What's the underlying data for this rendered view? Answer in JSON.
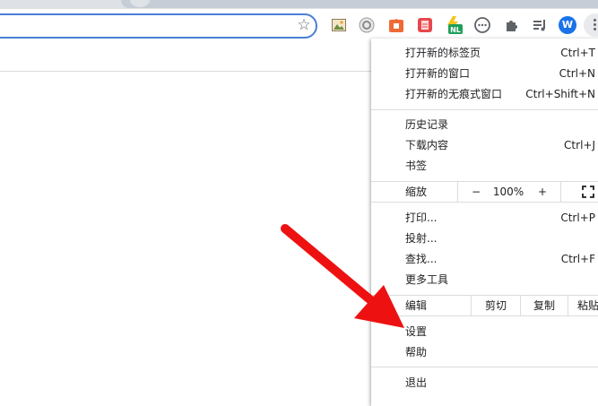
{
  "toolbar": {
    "star_icon": "star-icon",
    "avatar_letter": "W",
    "extensions": [
      "image-extension-icon",
      "gear-extension-icon",
      "shop-extension-icon",
      "red-extension-icon",
      "nl-extension-icon",
      "chat-extension-icon",
      "puzzle-icon",
      "media-icon"
    ],
    "nl_badge": "NL"
  },
  "menu": {
    "new_tab": {
      "label": "打开新的标签页",
      "shortcut": "Ctrl+T"
    },
    "new_window": {
      "label": "打开新的窗口",
      "shortcut": "Ctrl+N"
    },
    "new_incognito": {
      "label": "打开新的无痕式窗口",
      "shortcut": "Ctrl+Shift+N"
    },
    "history": {
      "label": "历史记录"
    },
    "downloads": {
      "label": "下载内容",
      "shortcut": "Ctrl+J"
    },
    "bookmarks": {
      "label": "书签"
    },
    "zoom": {
      "label": "缩放",
      "minus": "−",
      "value": "100%",
      "plus": "+"
    },
    "print": {
      "label": "打印...",
      "shortcut": "Ctrl+P"
    },
    "cast": {
      "label": "投射..."
    },
    "find": {
      "label": "查找...",
      "shortcut": "Ctrl+F"
    },
    "more_tools": {
      "label": "更多工具"
    },
    "edit": {
      "label": "编辑",
      "cut": "剪切",
      "copy": "复制",
      "paste": "粘贴"
    },
    "settings": {
      "label": "设置"
    },
    "help": {
      "label": "帮助"
    },
    "exit": {
      "label": "退出"
    }
  },
  "colors": {
    "accent": "#1a73e8",
    "arrow": "#ee1111"
  }
}
